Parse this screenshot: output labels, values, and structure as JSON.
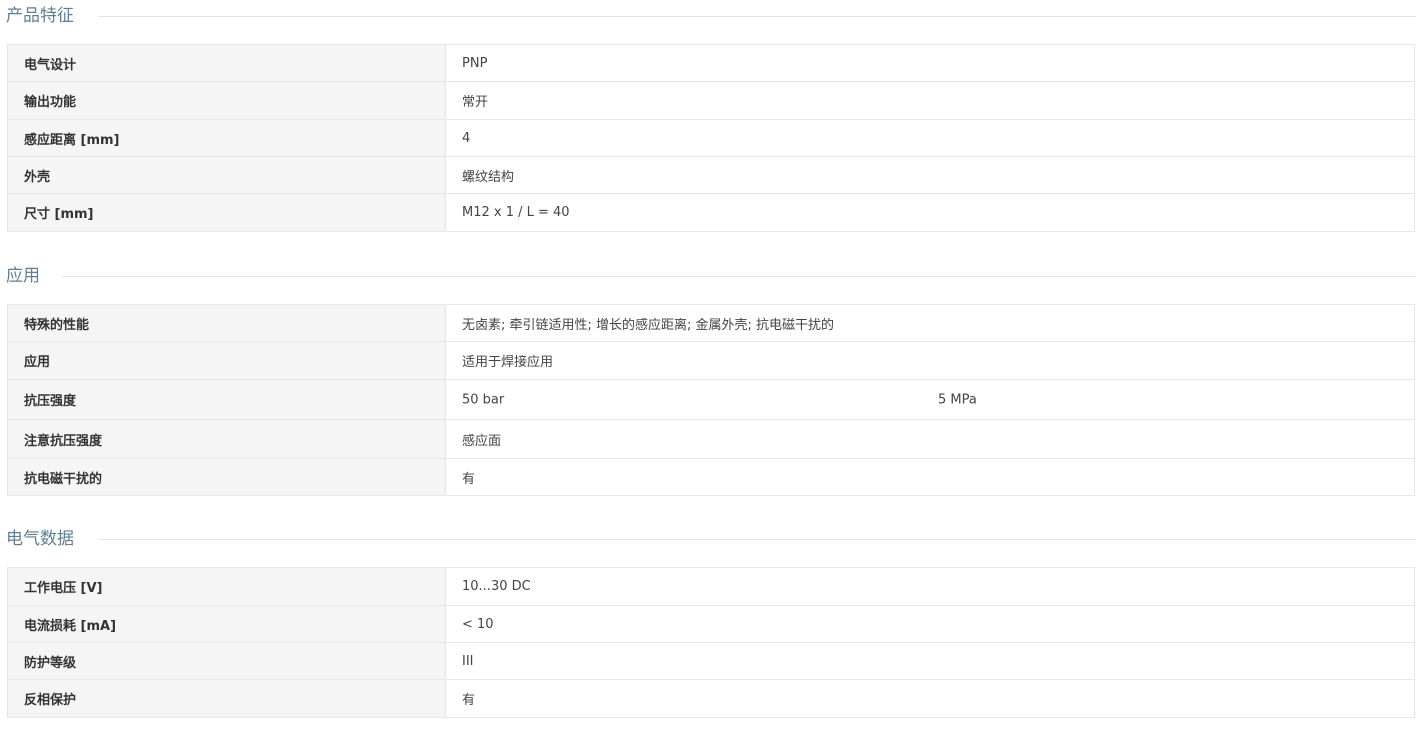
{
  "sections": [
    {
      "title": "产品特征",
      "rows": [
        {
          "label": "电气设计",
          "value": "PNP"
        },
        {
          "label": "输出功能",
          "value": "常开"
        },
        {
          "label": "感应距离 [mm]",
          "value": "4"
        },
        {
          "label": "外壳",
          "value": "螺纹结构"
        },
        {
          "label": "尺寸 [mm]",
          "value": "M12 x 1 / L = 40"
        }
      ]
    },
    {
      "title": "应用",
      "rows": [
        {
          "label": "特殊的性能",
          "value": "无卤素; 牵引链适用性; 增长的感应距离; 金属外壳; 抗电磁干扰的"
        },
        {
          "label": "应用",
          "value": "适用于焊接应用"
        },
        {
          "label": "抗压强度",
          "value": "50 bar",
          "value2": "5 MPa"
        },
        {
          "label": "注意抗压强度",
          "value": "感应面"
        },
        {
          "label": "抗电磁干扰的",
          "value": "有"
        }
      ]
    },
    {
      "title": "电气数据",
      "rows": [
        {
          "label": "工作电压 [V]",
          "value": "10...30 DC"
        },
        {
          "label": "电流损耗 [mA]",
          "value": "< 10"
        },
        {
          "label": "防护等级",
          "value": "III"
        },
        {
          "label": "反相保护",
          "value": "有"
        }
      ]
    }
  ]
}
